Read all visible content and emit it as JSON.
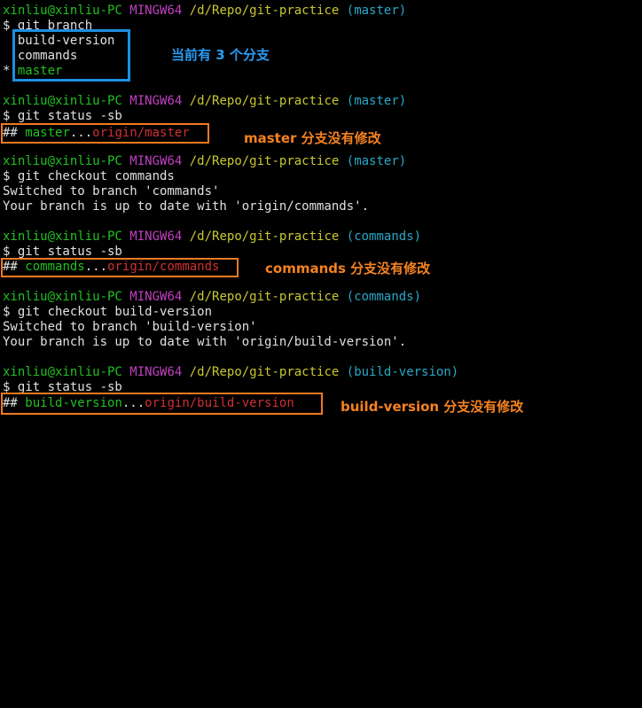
{
  "prompt": {
    "user": "xinliu@xinliu-PC",
    "system": "MINGW64",
    "path": "/d/Repo/git-practice"
  },
  "blocks": [
    {
      "branch": "(master)",
      "command": "$ git branch",
      "branch_list": [
        "build-version",
        "commands"
      ],
      "current_marker": "* ",
      "current_branch": "master"
    },
    {
      "branch": "(master)",
      "command": "$ git status -sb",
      "status_prefix": "## ",
      "status_local": "master",
      "status_dots": "...",
      "status_remote": "origin/master"
    },
    {
      "branch": "(master)",
      "command": "$ git checkout commands",
      "output": [
        "Switched to branch 'commands'",
        "Your branch is up to date with 'origin/commands'."
      ]
    },
    {
      "branch": "(commands)",
      "command": "$ git status -sb",
      "status_prefix": "## ",
      "status_local": "commands",
      "status_dots": "...",
      "status_remote": "origin/commands"
    },
    {
      "branch": "(commands)",
      "command": "$ git checkout build-version",
      "output": [
        "Switched to branch 'build-version'",
        "Your branch is up to date with 'origin/build-version'."
      ]
    },
    {
      "branch": "(build-version)",
      "command": "$ git status -sb",
      "status_prefix": "## ",
      "status_local": "build-version",
      "status_dots": "...",
      "status_remote": "origin/build-version"
    }
  ],
  "annotations": {
    "branch_count": "当前有 3 个分支",
    "master_unchanged": "master 分支没有修改",
    "commands_unchanged": "commands 分支没有修改",
    "build_version_unchanged": "build-version 分支没有修改"
  },
  "colors": {
    "blue_highlight": "#1d8fe0",
    "orange_highlight": "#f07a20"
  }
}
